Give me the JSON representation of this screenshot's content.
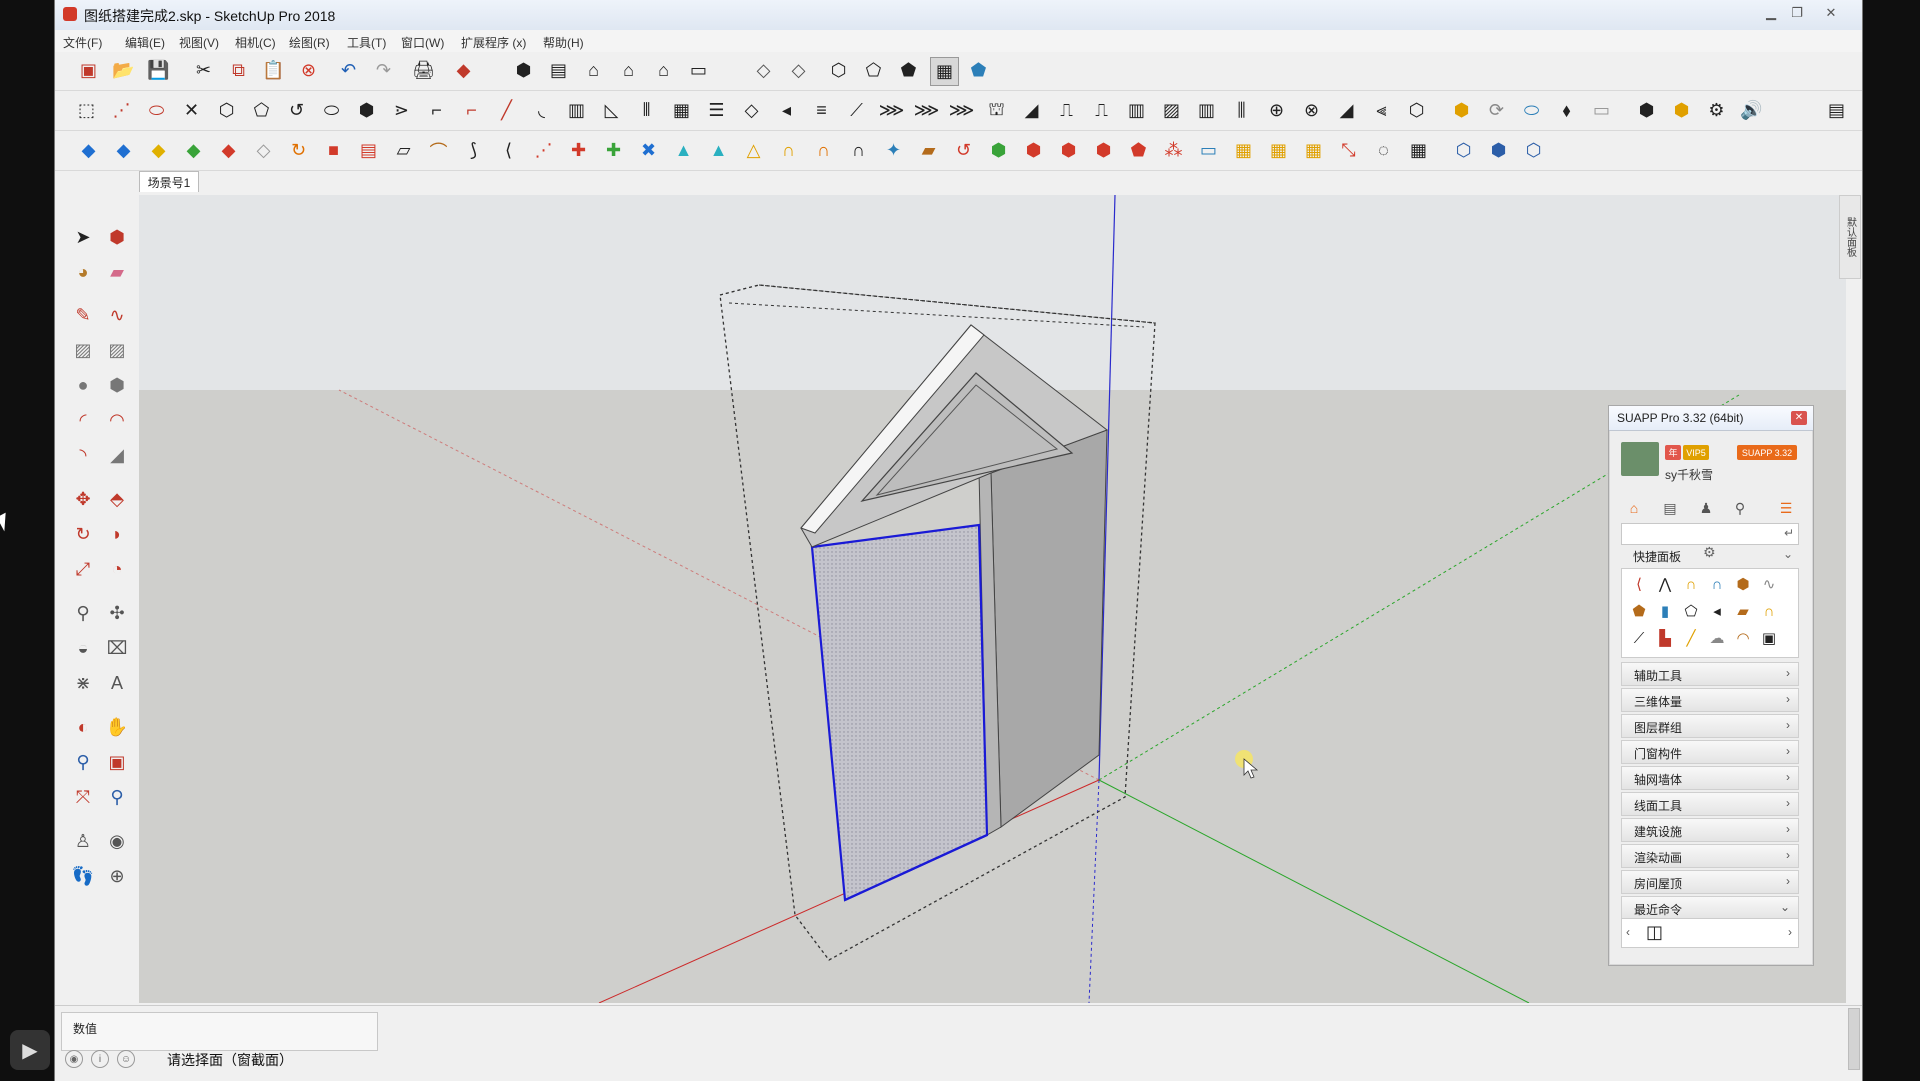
{
  "window": {
    "title": "图纸搭建完成2.skp - SketchUp Pro 2018"
  },
  "menu": [
    "文件(F)",
    "编辑(E)",
    "视图(V)",
    "相机(C)",
    "绘图(R)",
    "工具(T)",
    "窗口(W)",
    "扩展程序 (x)",
    "帮助(H)"
  ],
  "scene_tab": "场景号1",
  "right_tray_label": "默认面板",
  "suapp": {
    "title": "SUAPP Pro 3.32 (64bit)",
    "badge_year": "年",
    "badge_vip": "VIP5",
    "badge_version": "SUAPP 3.32",
    "user": "sy千秋雪",
    "quick_panel_label": "快捷面板",
    "sections": [
      "辅助工具",
      "三维体量",
      "图层群组",
      "门窗构件",
      "轴网墙体",
      "线面工具",
      "建筑设施",
      "渲染动画",
      "房间屋顶",
      "最近命令"
    ]
  },
  "status": {
    "value_label": "数值",
    "prompt": "请选择面（窗截面）"
  },
  "icons": {
    "window_close": "close-icon",
    "panel_close": "close-icon"
  },
  "colors": {
    "sky": "#e2e4e6",
    "ground": "#cfcfcc",
    "model_face": "#c9c9c9",
    "model_dark": "#9f9f9f",
    "selection_blue": "#1a1ad6",
    "axis_red": "#cc2a2a",
    "axis_green": "#2aa62a",
    "axis_blue": "#2a2acc"
  }
}
